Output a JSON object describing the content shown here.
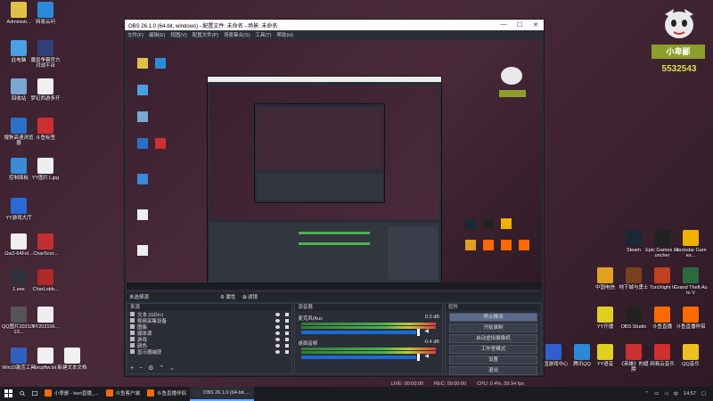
{
  "desktop": {
    "icons_left": [
      {
        "label": "Administr...",
        "color": "#e0c04a"
      },
      {
        "label": "网易云问",
        "color": "#2a8ad8"
      },
      {
        "label": "此电脑",
        "color": "#4aa0e0"
      },
      {
        "label": "魔兽争霸官方对战平台",
        "color": "#30407a"
      },
      {
        "label": "回收站",
        "color": "#7aa8d0"
      },
      {
        "label": "梦幻西游多开",
        "color": "#f0f0f0"
      },
      {
        "label": "搜狗高速浏览器",
        "color": "#2a70c8"
      },
      {
        "label": "斗鱼标签",
        "color": "#cc3030"
      },
      {
        "label": "控制面板",
        "color": "#3a8ad8"
      },
      {
        "label": "YY图片1.jpg",
        "color": "#eeeeee"
      },
      {
        "label": "YY游戏大厅",
        "color": "#2a6ad8"
      },
      {
        "label": "Gw2-64Fel...",
        "color": "#f0f0f0"
      },
      {
        "label": "CharScor...",
        "color": "#c03030"
      },
      {
        "label": "1.exe",
        "color": "#30303a"
      },
      {
        "label": "CharLobb...",
        "color": "#b02828"
      },
      {
        "label": "QQ图片20210623...",
        "color": "#555"
      },
      {
        "label": "YY202106...",
        "color": "#eeeeee"
      },
      {
        "label": "Win10激活工具",
        "color": "#3060c0"
      },
      {
        "label": "brcpftw.txt",
        "color": "#f0f0f0"
      },
      {
        "label": "新建文本文档",
        "color": "#f0f0f0"
      }
    ],
    "icons_right": [
      {
        "label": "Steam",
        "color": "#1b2838"
      },
      {
        "label": "Epic Games Launcher",
        "color": "#222"
      },
      {
        "label": "Rockstar Games...",
        "color": "#f0b000"
      },
      {
        "label": "中国电信",
        "color": "#e0a020"
      },
      {
        "label": "地下城与勇士",
        "color": "#7a4020"
      },
      {
        "label": "Torchlight II",
        "color": "#c04020"
      },
      {
        "label": "Grand Theft Auto V",
        "color": "#2a6a40"
      },
      {
        "label": "YY开播",
        "color": "#e0d020"
      },
      {
        "label": "OBS Studio",
        "color": "#222"
      },
      {
        "label": "斗鱼直播",
        "color": "#ff6a00"
      },
      {
        "label": "斗鱼直播伴侣",
        "color": "#ff6a00"
      },
      {
        "label": "中国游戏中心",
        "color": "#3060d0"
      },
      {
        "label": "腾讯QQ",
        "color": "#2a8ad8"
      },
      {
        "label": "YY语音",
        "color": "#e0d020"
      },
      {
        "label": "《英雄》的翅膀",
        "color": "#cc3030"
      },
      {
        "label": "网易云音乐",
        "color": "#d03030"
      },
      {
        "label": "QQ音乐",
        "color": "#f0c020"
      }
    ],
    "streamer": {
      "name": "小卑鄙",
      "count": "5532543"
    }
  },
  "obs": {
    "title": "OBS 26.1.0 (64-bit, windows) - 配置文件: 未命名 - 场景: 未命名",
    "menu": [
      "文件(F)",
      "编辑(E)",
      "视图(V)",
      "配置文件(P)",
      "场景集合(S)",
      "工具(T)",
      "帮助(H)"
    ],
    "window_buttons": {
      "min": "—",
      "max": "☐",
      "close": "✕"
    },
    "panel_bar": {
      "left": "未选择源",
      "properties": "属性",
      "filters": "滤镜"
    },
    "docks": {
      "sources_header": "来源",
      "mixer_header": "混音器",
      "controls_header": "控件"
    },
    "sources": [
      {
        "label": "文本 (GDI+)",
        "selected": false
      },
      {
        "label": "视频采集设备",
        "selected": false
      },
      {
        "label": "图像",
        "selected": false
      },
      {
        "label": "媒体源",
        "selected": false
      },
      {
        "label": "游戏",
        "selected": false
      },
      {
        "label": "颜色",
        "selected": false
      },
      {
        "label": "显示器捕获",
        "selected": false
      }
    ],
    "mixer": [
      {
        "name": "麦克风/Aux",
        "db": "0.0 dB"
      },
      {
        "name": "桌面音频",
        "db": "-0.4 dB"
      }
    ],
    "controls": [
      {
        "label": "停止推流",
        "active": true
      },
      {
        "label": "开始录制",
        "active": false
      },
      {
        "label": "启动虚拟摄像机",
        "active": false
      },
      {
        "label": "工作室模式",
        "active": false
      },
      {
        "label": "设置",
        "active": false
      },
      {
        "label": "退出",
        "active": false
      }
    ],
    "status": {
      "drop": "LIVE: 00:00:00",
      "rec": "REC: 00:00:00",
      "cpu": "CPU: 0.4%, 59.94 fps"
    }
  },
  "taskbar": {
    "items": [
      {
        "label": "小卑鄙 - bert直播_...",
        "color": "#ff6a00",
        "active": false
      },
      {
        "label": "斗鱼客户端",
        "color": "#ff6a00",
        "active": false
      },
      {
        "label": "斗鱼直播伴侣",
        "color": "#ff6a00",
        "active": false
      },
      {
        "label": "OBS 26.1.0 (64-bit, ...",
        "color": "#333",
        "active": true
      }
    ],
    "time": "14:57",
    "lang": "中"
  }
}
